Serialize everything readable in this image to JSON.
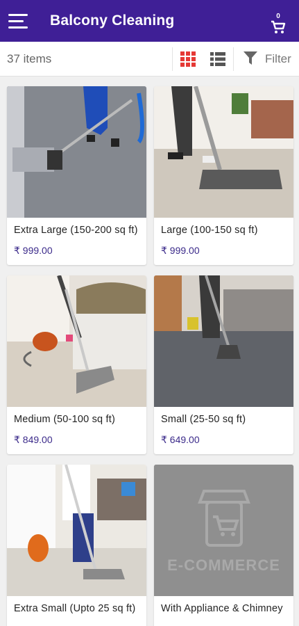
{
  "appbar": {
    "title": "Balcony Cleaning",
    "cart_count": "0"
  },
  "toolbar": {
    "item_count": "37 items",
    "filter_label": "Filter"
  },
  "colors": {
    "primary": "#3f1f96",
    "accent_red": "#e53935",
    "price": "#3b2a8a"
  },
  "products": [
    {
      "name": "Extra Large (150-200 sq ft)",
      "price": "₹ 999.00",
      "image": "carpet-vacuum-photo"
    },
    {
      "name": "Large (100-150 sq ft)",
      "price": "₹ 999.00",
      "image": "carpet-vacuum-living-room-photo"
    },
    {
      "name": "Medium (50-100 sq ft)",
      "price": "₹ 849.00",
      "image": "vacuum-near-sofa-photo"
    },
    {
      "name": "Small (25-50 sq ft)",
      "price": "₹ 649.00",
      "image": "grey-carpet-vacuum-photo"
    },
    {
      "name": "Extra Small (Upto 25 sq ft)",
      "price": "",
      "image": "vacuum-cleaner-room-photo"
    },
    {
      "name": "With Appliance & Chimney",
      "price": "",
      "image": "placeholder-image",
      "placeholder_text": "E-COMMERCE"
    }
  ]
}
